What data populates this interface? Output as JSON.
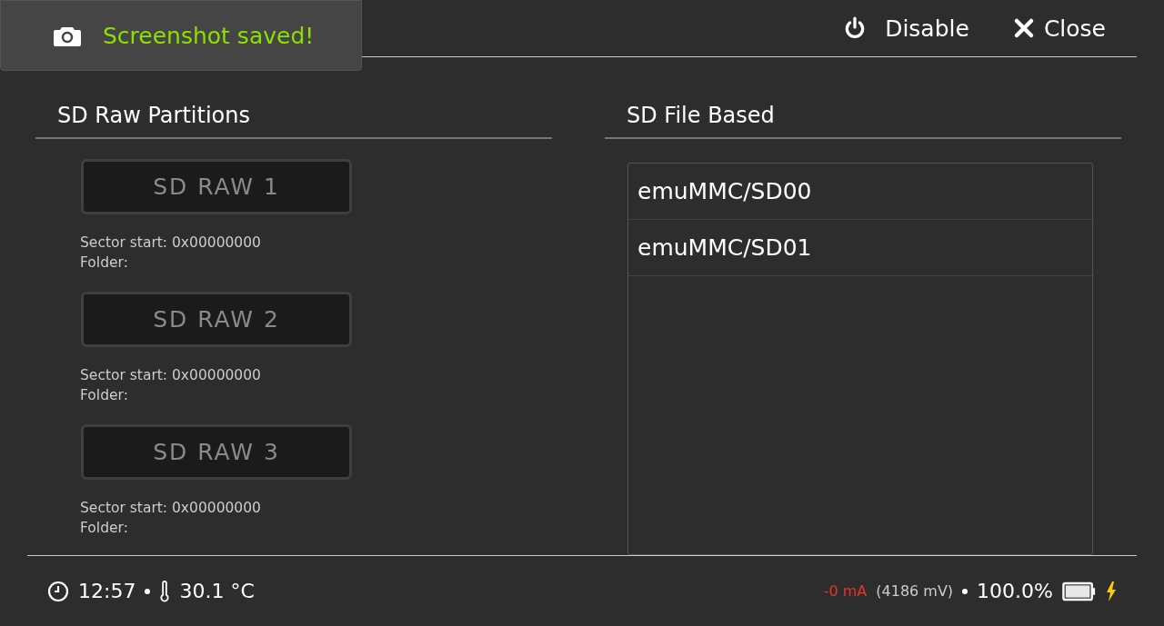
{
  "toast": {
    "text": "Screenshot saved!"
  },
  "header_actions": [
    {
      "label": "Disable",
      "kind": "power"
    },
    {
      "label": "Close",
      "kind": "close"
    }
  ],
  "raw_partitions": {
    "title": "SD Raw Partitions",
    "items": [
      {
        "label": "SD RAW 1",
        "sector": "Sector start: 0x00000000",
        "folder": "Folder:"
      },
      {
        "label": "SD RAW 2",
        "sector": "Sector start: 0x00000000",
        "folder": "Folder:"
      },
      {
        "label": "SD RAW 3",
        "sector": "Sector start: 0x00000000",
        "folder": "Folder:"
      }
    ]
  },
  "file_based": {
    "title": "SD File Based",
    "items": [
      "emuMMC/SD00",
      "emuMMC/SD01"
    ]
  },
  "status_bar": {
    "time": "12:57",
    "temperature": "30.1 °C",
    "current": "-0 mA",
    "voltage": "(4186 mV)",
    "battery": "100.0%",
    "charging": true
  }
}
